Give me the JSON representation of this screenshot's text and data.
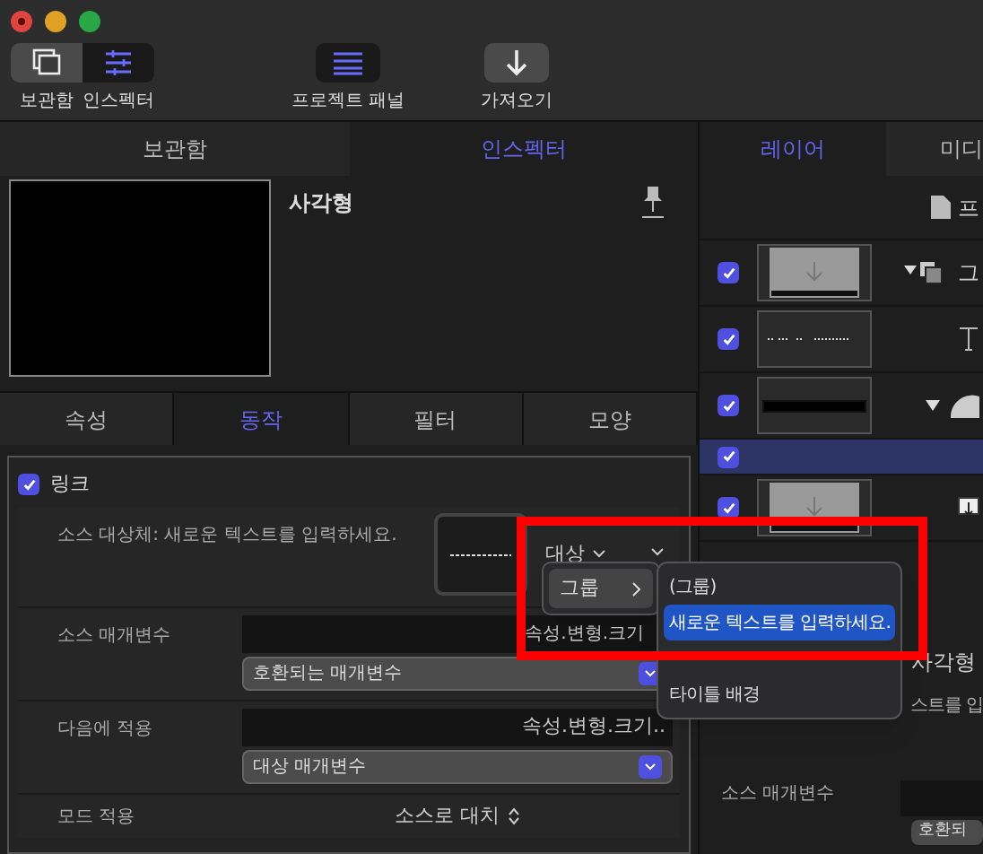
{
  "toolbar": {
    "buttons": [
      {
        "label": "보관함",
        "selected": false
      },
      {
        "label": "인스펙터",
        "selected": true
      }
    ],
    "tools": [
      {
        "label": "프로젝트 패널"
      },
      {
        "label": "가져오기"
      }
    ]
  },
  "left_tabs": [
    {
      "label": "보관함",
      "selected": false
    },
    {
      "label": "인스펙터",
      "selected": true
    }
  ],
  "object": {
    "name": "사각형"
  },
  "inspector_tabs": [
    {
      "label": "속성",
      "selected": false
    },
    {
      "label": "동작",
      "selected": true
    },
    {
      "label": "필터",
      "selected": false
    },
    {
      "label": "모양",
      "selected": false
    }
  ],
  "link": {
    "label": "링크",
    "checked": true,
    "source_label": "소스 대상체: 새로운 텍스트를 입력하세요.",
    "target": "대상",
    "source_param": {
      "label": "소스 매개변수",
      "value": "속성.변형.크기",
      "popup": "호환되는 매개변수"
    },
    "apply_to": {
      "label": "다음에 적용",
      "value": "속성.변형.크기..",
      "popup": "대상 매개변수"
    },
    "mode": {
      "label": "모드 적용",
      "value": "소스로 대치"
    }
  },
  "menu": {
    "items": [
      {
        "label": "그룹",
        "selected": true
      }
    ],
    "submenu": [
      {
        "label": "(그룹)",
        "selected": false
      },
      {
        "label": "새로운 텍스트를 입력하세요.",
        "selected": true
      },
      {
        "label": "타이틀 배경",
        "selected": false
      }
    ]
  },
  "right_tabs": [
    {
      "label": "레이어",
      "selected": true
    },
    {
      "label": "미디",
      "selected": false
    }
  ],
  "layers": [
    {
      "kind": "project",
      "name": "프"
    },
    {
      "kind": "group",
      "checked": true,
      "selected": false,
      "name": "그"
    },
    {
      "kind": "text",
      "checked": true,
      "selected": false
    },
    {
      "kind": "shape",
      "checked": true,
      "selected": false
    },
    {
      "kind": "empty",
      "checked": true,
      "selected": true
    },
    {
      "kind": "image",
      "checked": true,
      "selected": false
    }
  ],
  "right_lower": {
    "title": "사각형",
    "subtitle": "스트를 입",
    "param_label": "소스 매개변수",
    "popup": "호환되"
  }
}
